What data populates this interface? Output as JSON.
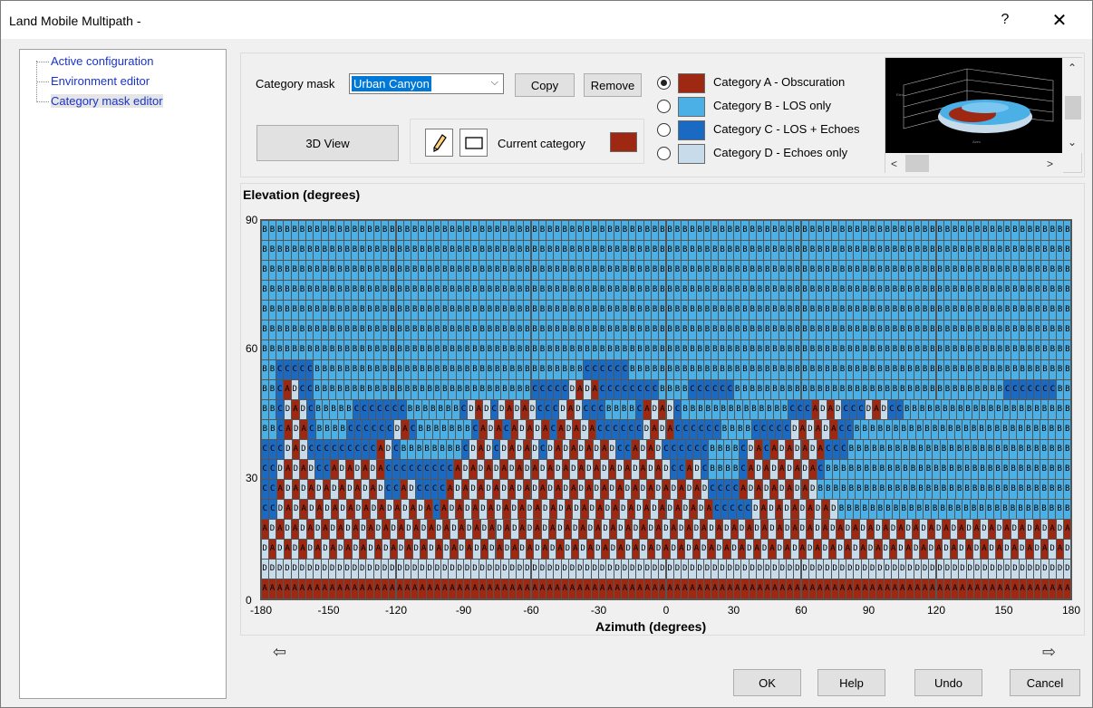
{
  "window": {
    "title": "Land Mobile Multipath -",
    "help": "?",
    "close": "✕"
  },
  "tree": {
    "items": [
      {
        "label": "Active configuration"
      },
      {
        "label": "Environment editor"
      },
      {
        "label": "Category mask editor"
      }
    ]
  },
  "mask": {
    "label": "Category mask",
    "value": "Urban Canyon",
    "copy": "Copy",
    "remove": "Remove"
  },
  "view3d": "3D View",
  "current_category": {
    "label": "Current category",
    "color": "#9e2811"
  },
  "categories": [
    {
      "label": "Category A - Obscuration",
      "color": "#9e2811",
      "selected": true
    },
    {
      "label": "Category B - LOS only",
      "color": "#4bb0e6",
      "selected": false
    },
    {
      "label": "Category C - LOS + Echoes",
      "color": "#1a6ac4",
      "selected": false
    },
    {
      "label": "Category D - Echoes only",
      "color": "#c7dbea",
      "selected": false
    }
  ],
  "grid": {
    "ylabel": "Elevation (degrees)",
    "xlabel": "Azimuth (degrees)",
    "yticks": [
      "90",
      "60",
      "30",
      "0"
    ],
    "xticks": [
      "-180",
      "-150",
      "-120",
      "-90",
      "-60",
      "-30",
      "0",
      "30",
      "60",
      "90",
      "120",
      "150",
      "180"
    ],
    "rows": [
      "BBBBBBBBBBBBBBBBBBBBBBBBBBBBBBBBBBBBBBBBBBBBBBBBBBBBBBBBBBBBBBBBBBBBBBBBBBBBBBBBBBBBBBBBBBBBBBBBBBBBBBBBBBBB",
      "BBBBBBBBBBBBBBBBBBBBBBBBBBBBBBBBBBBBBBBBBBBBBBBBBBBBBBBBBBBBBBBBBBBBBBBBBBBBBBBBBBBBBBBBBBBBBBBBBBBBBBBBBBBB",
      "BBBBBBBBBBBBBBBBBBBBBBBBBBBBBBBBBBBBBBBBBBBBBBBBBBBBBBBBBBBBBBBBBBBBBBBBBBBBBBBBBBBBBBBBBBBBBBBBBBBBBBBBBBBB",
      "BBBBBBBBBBBBBBBBBBBBBBBBBBBBBBBBBBBBBBBBBBBBBBBBBBBBBBBBBBBBBBBBBBBBBBBBBBBBBBBBBBBBBBBBBBBBBBBBBBBBBBBBBBBB",
      "BBBBBBBBBBBBBBBBBBBBBBBBBBBBBBBBBBBBBBBBBBBBBBBBBBBBBBBBBBBBBBBBBBBBBBBBBBBBBBBBBBBBBBBBBBBBBBBBBBBBBBBBBBBB",
      "BBBBBBBBBBBBBBBBBBBBBBBBBBBBBBBBBBBBBBBBBBBBBBBBBBBBBBBBBBBBBBBBBBBBBBBBBBBBBBBBBBBBBBBBBBBBBBBBBBBBBBBBBBBB",
      "BBBBBBBBBBBBBBBBBBBBBBBBBBBBBBBBBBBBBBBBBBBBBBBBBBBBBBBBBBBBBBBBBBBBBBBBBBBBBBBBBBBBBBBBBBBBBBBBBBBBBBBBBBBB",
      "BBCCCCCBBBBBBBBBBBBBBBBBBBBBBBBBBBBBBBBBBBBCCCCCCBBBBBBBBBBBBBBBBBBBBBBBBBBBBBBBBBBBBBBBBBBBBBBBBBBBBBBBBBBB",
      "BBCADCCBBBBBBBBBBBBBBBBBBBBBBBBBBBBBCCCCCDADACCCCCCCCBBBBCCCCCCBBBBBBBBBBBBBBBBBBBBBBBBBBBBBBBBBBBBCCCCCCCBB",
      "BBCDADCBBBBBCCCCCCCBBBBBBBCDADCDADADCCCDADCCCBBBBCADADCBBBBBBBBBBBBBBCCCADADCCCDADCCBBBBBBBBBBBBBBBBBBBBBB",
      "BBCADACBBBBCCCCCCDACBBBBBBBCADACADADACADADACCCCCCDADACCCCCCBBBBCCCCCDADADACCBBBBBBBBBBBBBBBBBBBBBBBBBBBB",
      "CCCDADCCCCCCCCCADCBBBBBBBBCDADCDADADCDADADADADCCADADCCCCCCBBBBCDACADADADACCCBBBBBBBBBBBBBBBBBBBBBBBBBBBBB",
      "CCDADADCCADADADACCCCCCCCCADADADADADADADADADADADADADADCCADCBBBBCADADADADACBBBBBBBBBBBBBBBBBBBBBBBBBBBBBBBB",
      "CCADADADADADADADCCADCCCCADADADADADADADADADADADADADADADADADCCCCADADADADADBBBBBBBBBBBBBBBBBBBBBBBBBBBBBBBBB",
      "CCDADADADADADADADADADACADADADADADADADADADADADADADADADADADACCCCCDADADADADADBBBBBBBBBBBBBBBBBBBBBBBBBBBBBB",
      "ADADADADADADADADADADADADADADADADADADADADADADADADADADADADADADADADADADADADADADADADADADADADADADADADADADADADADA",
      "DADADADADADADADADADADADADADADADADADADADADADADADADADADADADADADADADADADADADADADADADADADADADADADADADADADADADAD",
      "DDDDDDDDDDDDDDDDDDDDDDDDDDDDDDDDDDDDDDDDDDDDDDDDDDDDDDDDDDDDDDDDDDDDDDDDDDDDDDDDDDDDDDDDDDDDDDDDDDDDDDDDDDDD",
      "AAAAAAAAAAAAAAAAAAAAAAAAAAAAAAAAAAAAAAAAAAAAAAAAAAAAAAAAAAAAAAAAAAAAAAAAAAAAAAAAAAAAAAAAAAAAAAAAAAAAAAAAAAAA"
    ]
  },
  "nav": {
    "prev_icon": "arrow-left-icon",
    "next_icon": "arrow-right-icon",
    "prev": "⇦",
    "next": "⇨"
  },
  "buttons": {
    "ok": "OK",
    "help": "Help",
    "undo": "Undo",
    "cancel": "Cancel"
  }
}
